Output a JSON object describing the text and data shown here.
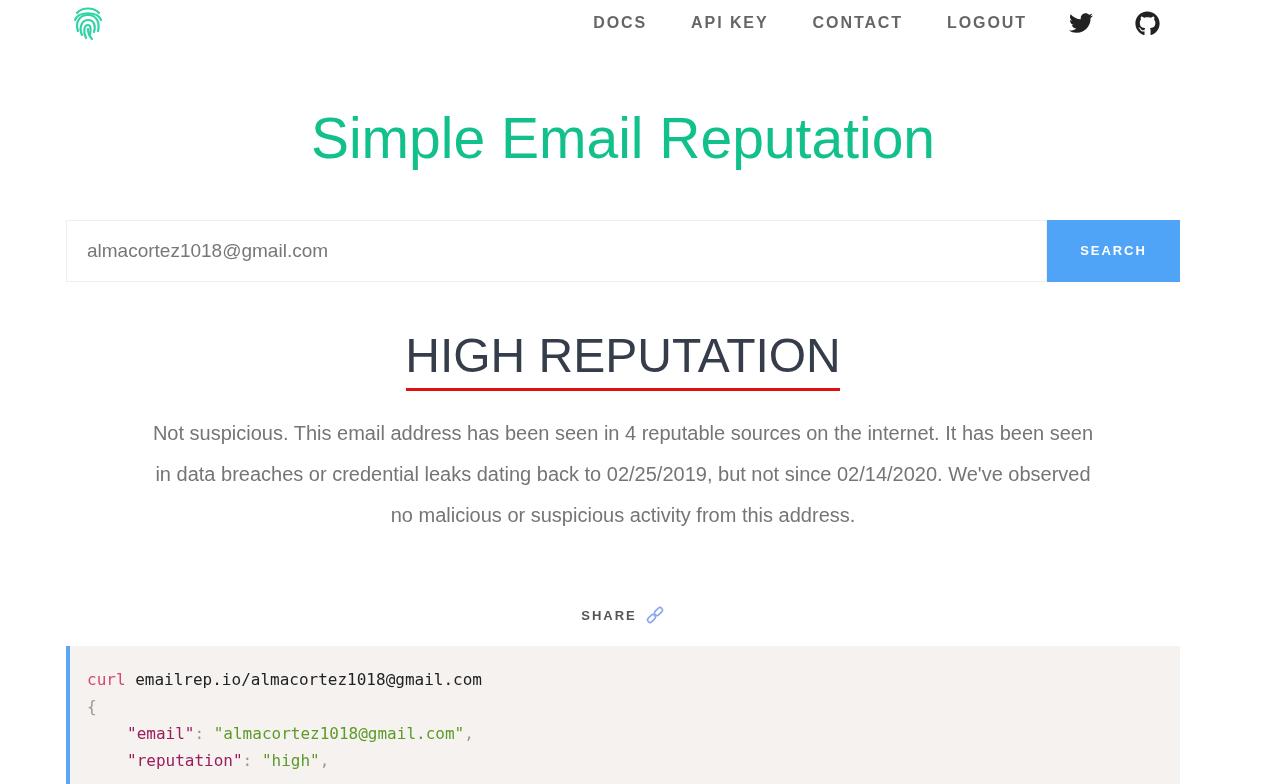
{
  "nav": {
    "links": [
      {
        "label": "DOCS"
      },
      {
        "label": "API KEY"
      },
      {
        "label": "CONTACT"
      },
      {
        "label": "LOGOUT"
      }
    ]
  },
  "title": "Simple Email Reputation",
  "search": {
    "value": "almacortez1018@gmail.com",
    "button": "SEARCH"
  },
  "result": {
    "heading": "HIGH REPUTATION",
    "description": "Not suspicious. This email address has been seen in 4 reputable sources on the internet. It has been seen in data breaches or credential leaks dating back to 02/25/2019, but not since 02/14/2020. We've observed no malicious or suspicious activity from this address."
  },
  "share": {
    "label": "SHARE"
  },
  "code": [
    {
      "kind": "command",
      "command": "curl",
      "argument": "emailrep.io/almacortez1018@gmail.com"
    },
    {
      "kind": "brace",
      "text": "{"
    },
    {
      "kind": "pair",
      "key": "\"email\"",
      "separator": ":",
      "value": "\"almacortez1018@gmail.com\"",
      "trailing": ","
    },
    {
      "kind": "pair",
      "key": "\"reputation\"",
      "separator": ":",
      "value": "\"high\"",
      "trailing": ","
    }
  ]
}
